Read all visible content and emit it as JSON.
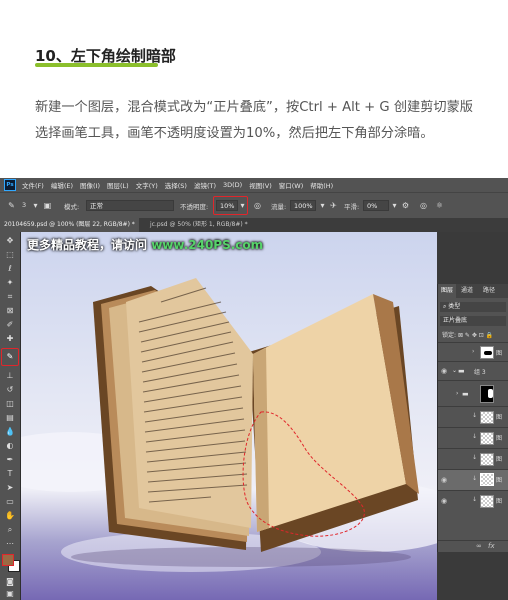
{
  "article": {
    "title": "10、左下角绘制暗部",
    "paragraph": "新建一个图层，混合模式改为“正片叠底”，按Ctrl + Alt + G 创建剪切蒙版选择画笔工具，画笔不透明度设置为10%，然后把左下角部分涂暗。"
  },
  "photoshop": {
    "app_icon": "Ps",
    "menu": [
      "文件(F)",
      "编辑(E)",
      "图像(I)",
      "图层(L)",
      "文字(Y)",
      "选择(S)",
      "滤镜(T)",
      "3D(D)",
      "视图(V)",
      "窗口(W)",
      "帮助(H)"
    ],
    "options": {
      "size": "3",
      "mode_label": "模式:",
      "mode_value": "正常",
      "opacity_label": "不透明度:",
      "opacity_value": "10%",
      "flow_label": "流量:",
      "flow_value": "100%",
      "smooth_label": "平滑:",
      "smooth_value": "0%"
    },
    "tabs": [
      "20104659.psd @ 100% (图层 22, RGB/8#) *",
      "jc.psd @ 50% (矩形 1, RGB/8#) *"
    ],
    "watermark": {
      "text": "更多精品教程，请访问",
      "url": "www.240PS.com"
    },
    "layers_panel": {
      "tabs": [
        "图层",
        "通道",
        "路径"
      ],
      "filter": "类型",
      "blend_mode": "正片叠底",
      "lock_label": "锁定:",
      "layers": [
        {
          "name": "图",
          "type": "mask"
        },
        {
          "name": "组 3",
          "type": "group"
        },
        {
          "name": "",
          "type": "mask-group"
        },
        {
          "name": "图",
          "type": "clip"
        },
        {
          "name": "图",
          "type": "clip"
        },
        {
          "name": "图",
          "type": "clip"
        },
        {
          "name": "图",
          "type": "clip-selected"
        },
        {
          "name": "图",
          "type": "clip"
        }
      ],
      "footer": "fx"
    },
    "colors": {
      "accent_red": "#e0262b",
      "underline_green": "#8bbf2c",
      "watermark_green": "#57d36a"
    }
  }
}
